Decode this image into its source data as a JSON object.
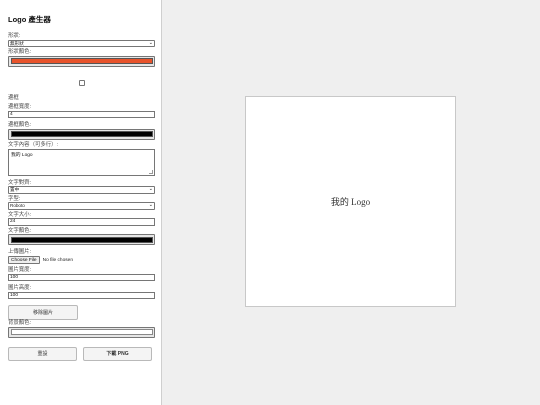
{
  "sidebar": {
    "title": "Logo 產生器",
    "shape_label": "形狀:",
    "shape_value": "無形狀",
    "shape_color_label": "形狀顏色:",
    "shape_color": "#e8532b",
    "border_section_label": "邊框",
    "border_width_label": "邊框寬度:",
    "border_width_value": "4",
    "border_color_label": "邊框顏色:",
    "border_color": "#000000",
    "text_content_label": "文字內容（可多行）:",
    "text_content_value": "我的 Logo",
    "text_align_label": "文字對齊:",
    "text_align_value": "置中",
    "font_label": "字型:",
    "font_value": "Roboto",
    "font_size_label": "文字大小:",
    "font_size_value": "24",
    "text_color_label": "文字顏色:",
    "text_color": "#000000",
    "upload_label": "上傳圖片:",
    "file_button_label": "Choose File",
    "file_status": "No file chosen",
    "image_width_label": "圖片寬度:",
    "image_width_value": "100",
    "image_height_label": "圖片高度:",
    "image_height_value": "100",
    "remove_image_label": "移除圖片",
    "bg_color_label": "背景顏色:",
    "bg_color": "#ffffff",
    "reset_label": "重設",
    "download_label": "下載 PNG"
  },
  "preview": {
    "text": "我的 Logo"
  }
}
